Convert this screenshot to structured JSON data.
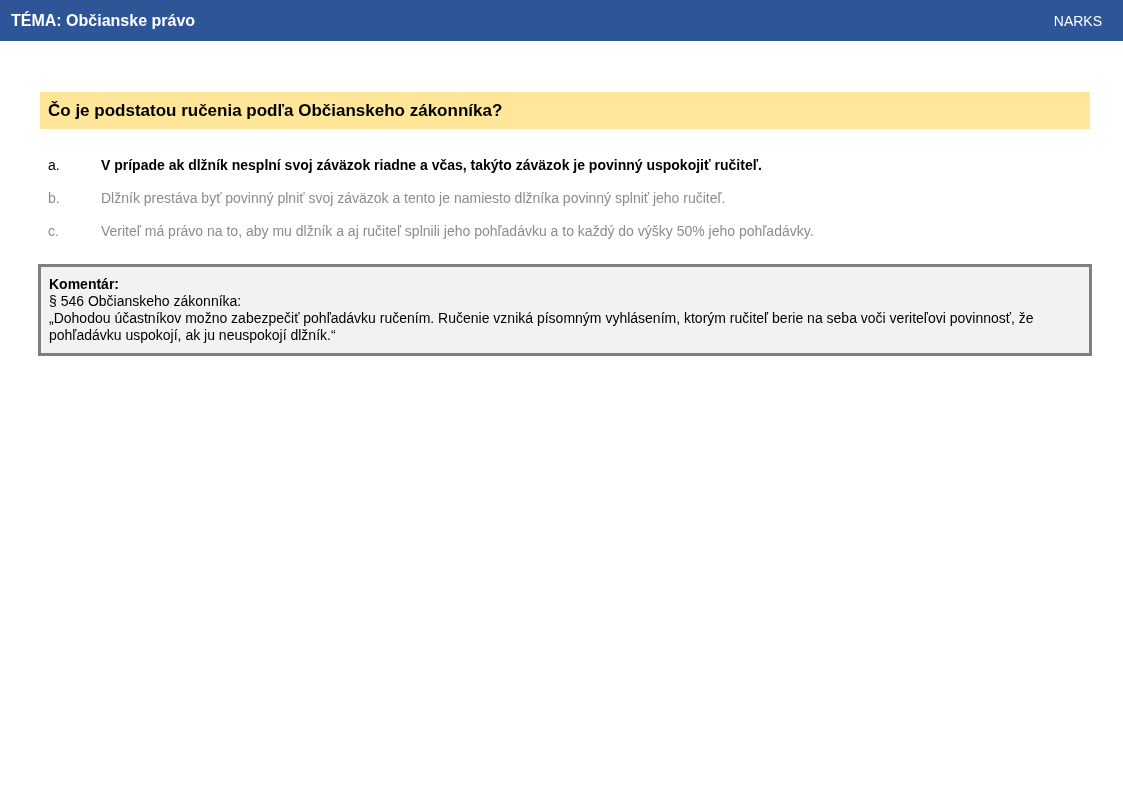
{
  "header": {
    "topic": "TÉMA: Občianske právo",
    "brand": "NARKS"
  },
  "question": "Čo je podstatou ručenia podľa Občianskeho zákonníka?",
  "answers": [
    {
      "letter": "a.",
      "text": "V prípade ak dlžník nesplní svoj záväzok riadne a včas, takýto záväzok je povinný uspokojiť ručiteľ.",
      "selected": true
    },
    {
      "letter": "b.",
      "text": "Dlžník prestáva byť povinný plniť svoj záväzok a tento je namiesto dlžníka povinný splniť jeho ručiteľ.",
      "selected": false
    },
    {
      "letter": "c.",
      "text": "Veriteľ má právo na to, aby mu dlžník a aj ručiteľ splnili jeho pohľadávku a to každý do výšky 50% jeho pohľadávky.",
      "selected": false
    }
  ],
  "comment": {
    "title": "Komentár:",
    "source": "§ 546 Občianskeho zákonníka:",
    "quote": "„Dohodou účastníkov možno zabezpečiť pohľadávku ručením. Ručenie vzniká písomným vyhlásením, ktorým ručiteľ berie na seba voči veriteľovi povinnosť, že pohľadávku uspokojí, ak ju neuspokojí dlžník.“"
  }
}
